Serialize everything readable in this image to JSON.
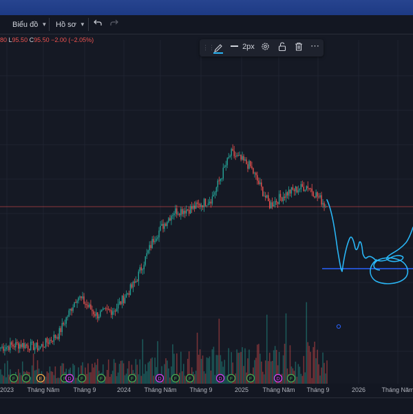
{
  "toolbar": {
    "chart_label": "Biểu đồ",
    "profile_label": "Hồ sơ",
    "undo_icon": "undo-icon",
    "redo_icon": "redo-icon"
  },
  "ohlc": {
    "h_tail": "80",
    "l_label": "L",
    "l_value": "95.50",
    "c_label": "C",
    "c_value": "95.50",
    "change": "−2.00 (−2.05%)"
  },
  "drawing_toolbar": {
    "width_label": "2px",
    "icons": [
      "drag-handle-icon",
      "pencil-icon",
      "line-width-icon",
      "settings-icon",
      "lock-icon",
      "trash-icon",
      "more-icon"
    ]
  },
  "time_axis": {
    "labels": [
      "2023",
      "Tháng Năm",
      "Tháng 9",
      "2024",
      "Tháng Năm",
      "Tháng 9",
      "2025",
      "Tháng Năm",
      "Tháng 9",
      "2026",
      "Tháng Năm"
    ]
  },
  "chart_data": {
    "type": "candlestick",
    "x": [
      "2023-01",
      "2023-03",
      "2023-05",
      "2023-07",
      "2023-09",
      "2023-11",
      "2024-01",
      "2024-03",
      "2024-05",
      "2024-07",
      "2024-09",
      "2024-11",
      "2025-01",
      "2025-02",
      "2025-04",
      "2025-06",
      "2025-08",
      "2025-09"
    ],
    "close_trend": [
      52,
      53,
      52,
      56,
      68,
      62,
      64,
      72,
      86,
      94,
      95,
      98,
      112,
      108,
      96,
      100,
      102,
      95.5
    ],
    "last_close": 95.5,
    "event_markers": [
      "F",
      "F",
      "E",
      "F",
      "D",
      "F",
      "F",
      "F",
      "D",
      "F",
      "F",
      "D",
      "F",
      "F",
      "D",
      "F"
    ],
    "colors": {
      "up": "#26a69a",
      "down": "#ef5350",
      "drawing": "#29b6f6",
      "hline": "#2962ff",
      "current_price_line": "#ef5350"
    }
  }
}
